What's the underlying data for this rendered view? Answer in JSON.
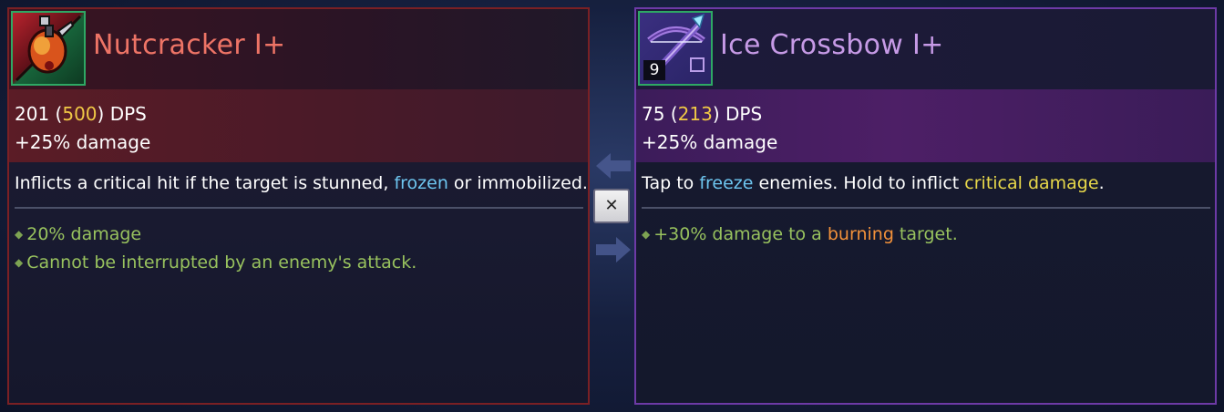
{
  "left_item": {
    "name": "Nutcracker I+",
    "dps_value": "201",
    "dps_max": "500",
    "dps_suffix": "DPS",
    "stat_bonus": "+25% damage",
    "description_parts": [
      "Inflicts a critical hit if the target is stunned, ",
      "frozen",
      " or immobilized."
    ],
    "bonuses": [
      "20% damage",
      "Cannot be interrupted by an enemy's attack."
    ],
    "icon": "nutcracker-weapon-icon"
  },
  "right_item": {
    "name": "Ice Crossbow I+",
    "count": "9",
    "dps_value": "75",
    "dps_max": "213",
    "dps_suffix": "DPS",
    "stat_bonus": "+25% damage",
    "description_parts": [
      "Tap to ",
      "freeze",
      " enemies. Hold to inflict ",
      "critical damage",
      "."
    ],
    "bonus_parts": [
      "+30% damage to a ",
      "burning",
      " target."
    ],
    "icon": "ice-crossbow-weapon-icon"
  },
  "controls": {
    "swap_icon": "swap-arrows-icon",
    "close_symbol": "✕"
  },
  "colors": {
    "left_border": "#7a2024",
    "right_border": "#6d3aa6",
    "rarity_green": "#2ea864",
    "dps_highlight": "#f0c845",
    "frozen_blue": "#6ec6f0",
    "critical_yellow": "#e8d84a",
    "burning_orange": "#f2913a",
    "bonus_green": "#98c25e"
  }
}
